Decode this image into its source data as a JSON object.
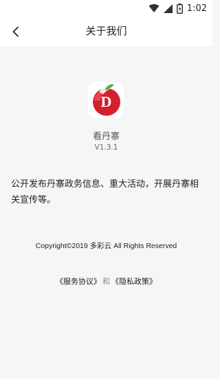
{
  "status_bar": {
    "time": "1:02",
    "icons": [
      "wifi-icon",
      "signal-icon",
      "battery-charging-icon"
    ]
  },
  "header": {
    "title": "关于我们",
    "back_icon": "chevron-left-icon"
  },
  "app": {
    "name": "看丹寨",
    "version": "V1.3.1",
    "logo_letter": "D",
    "logo_color": "#d4202c"
  },
  "description": "公开发布丹寨政务信息、重大活动，开展丹寨相关宣传等。",
  "footer": {
    "copyright": "Copyright©2019 多彩云 All Rights Reserved",
    "service_agreement": "《服务协议》",
    "and": "和",
    "privacy_policy": "《隐私政策》"
  }
}
